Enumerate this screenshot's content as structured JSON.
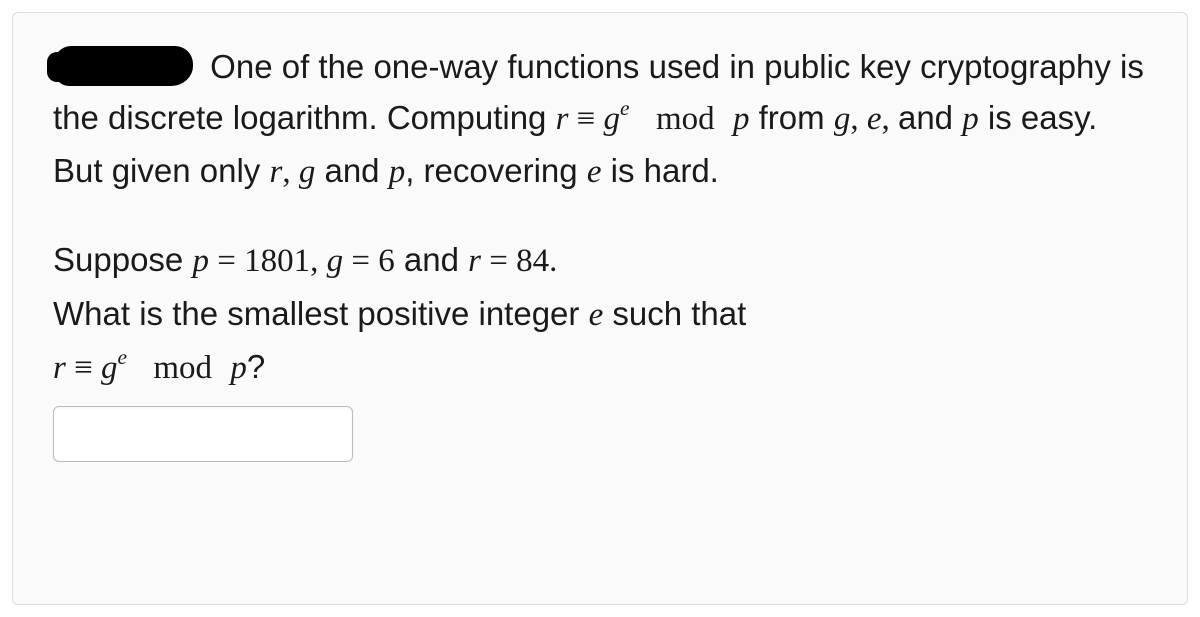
{
  "intro": {
    "lead_in": " One of the one-way functions used in public key cryptography is the discrete logarithm. Computing ",
    "eq1_r": "r",
    "eq1_equiv": " ≡ ",
    "eq1_g": "g",
    "eq1_e_sup": "e",
    "eq1_mod": "mod",
    "eq1_p": "p",
    "mid1": " from ",
    "list_g": "g",
    "comma1": ", ",
    "list_e": "e",
    "comma2": ", ",
    "and1": " and ",
    "list_p": "p",
    "easy": " is easy. But given only ",
    "only_r": "r",
    "comma3": ", ",
    "only_g": "g",
    "and2": " and ",
    "only_p": "p",
    "tail": ", recovering ",
    "tail_e": "e",
    "tail2": " is hard."
  },
  "question": {
    "suppose": "Suppose ",
    "p_var": "p",
    "eq": " = ",
    "p_val": "1801",
    "sep1": ", ",
    "g_var": "g",
    "eq2": " = ",
    "g_val": "6",
    "and": " and ",
    "r_var": "r",
    "eq3": " = ",
    "r_val": "84",
    "period": ".",
    "ask1": "What is the smallest positive integer ",
    "ask_e": "e",
    "ask2": " such that",
    "eq_r": "r",
    "eq_equiv": " ≡ ",
    "eq_g": "g",
    "eq_e_sup": "e",
    "eq_mod": "mod",
    "eq_p": "p",
    "qmark": "?"
  },
  "answer_value": ""
}
